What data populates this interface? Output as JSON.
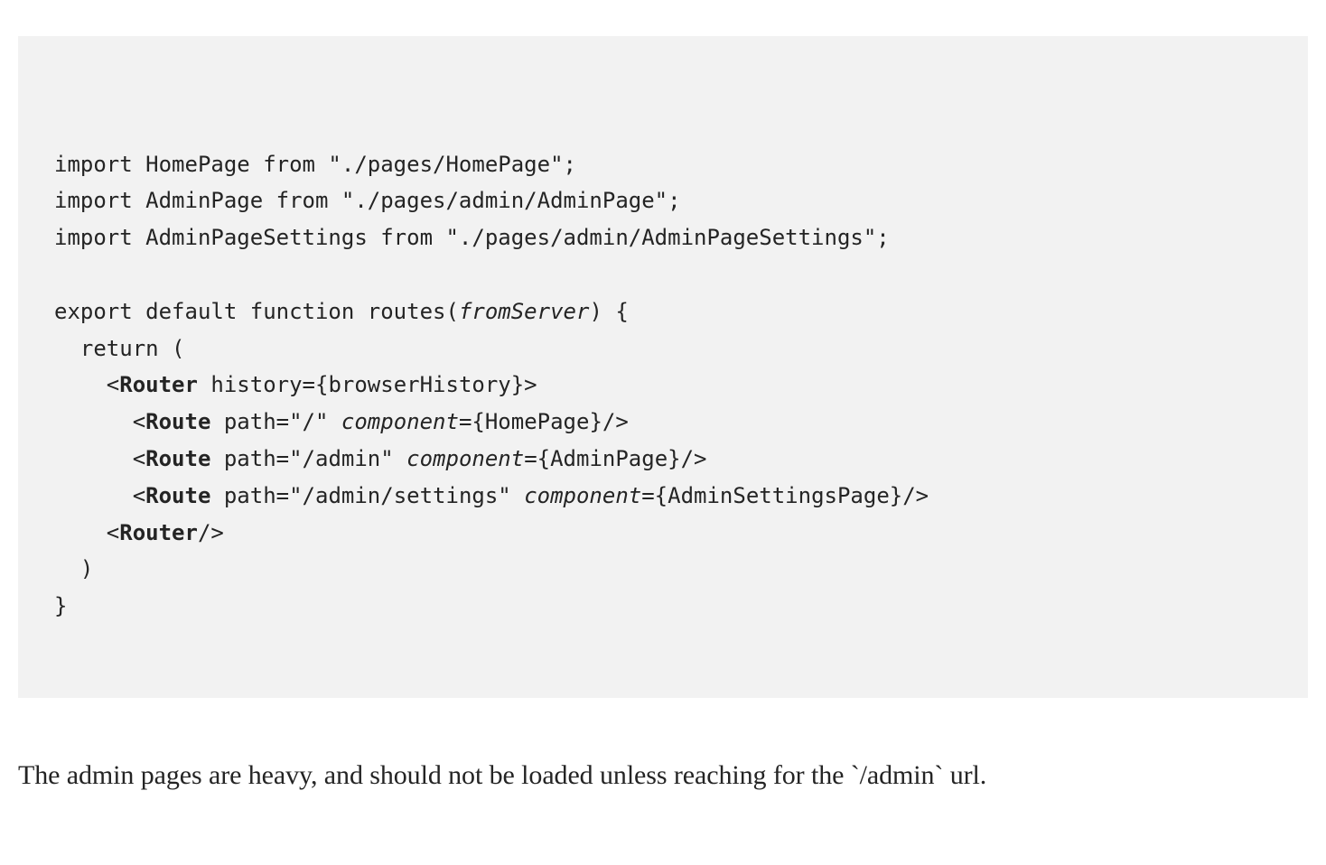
{
  "code": {
    "lines": [
      "import HomePage from \"./pages/HomePage\";",
      "import AdminPage from \"./pages/admin/AdminPage\";",
      "import AdminPageSettings from \"./pages/admin/AdminPageSettings\";",
      "",
      "export default function routes(<i>fromServer</i>) {",
      "  return (",
      "    <<b>Router</b> history={browserHistory}>",
      "      <<b>Route</b> path=\"/\" <i>component</i>={HomePage}/>",
      "      <<b>Route</b> path=\"/admin\" <i>component</i>={AdminPage}/>",
      "      <<b>Route</b> path=\"/admin/settings\" <i>component</i>={AdminSettingsPage}/>",
      "    <<b>Router</b>/>",
      "  )",
      "}"
    ]
  },
  "prose": {
    "text": "The admin pages are heavy, and should not be loaded unless reaching for the `/admin` url."
  }
}
